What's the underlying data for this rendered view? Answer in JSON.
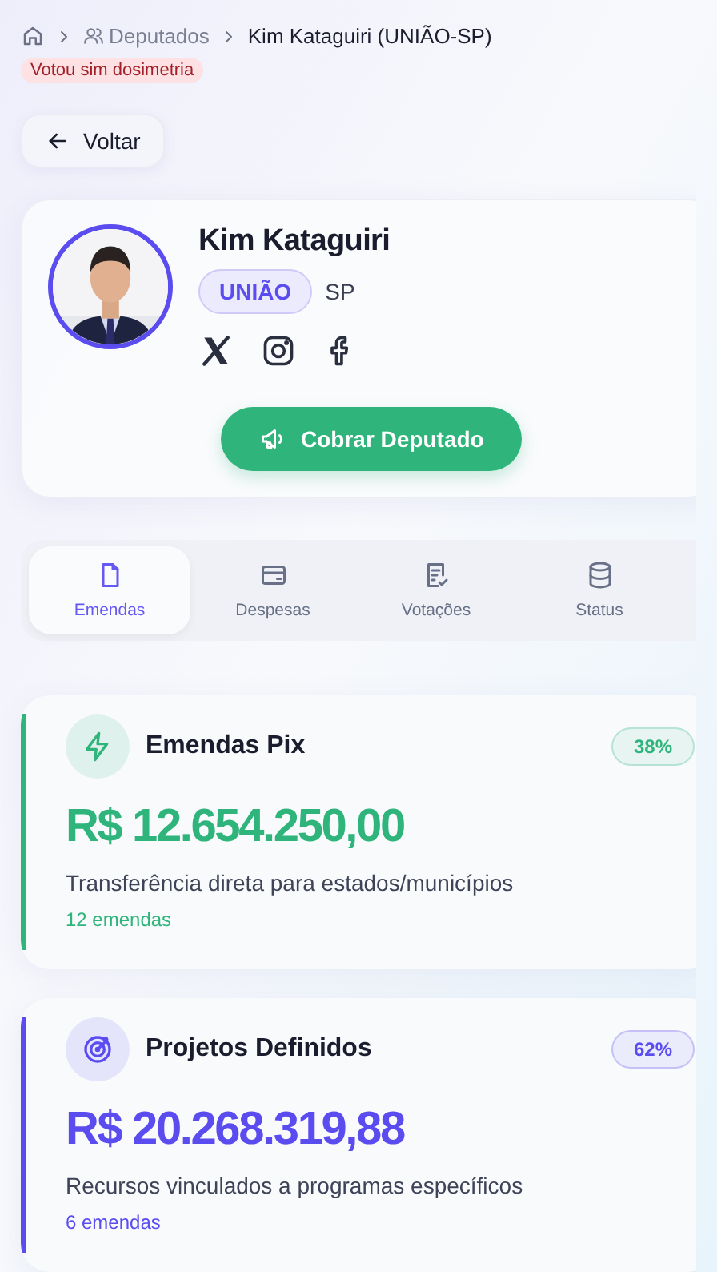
{
  "breadcrumb": [
    {
      "kind": "home"
    },
    {
      "kind": "people",
      "label": "Deputados"
    },
    {
      "kind": "current",
      "label": "Kim Kataguiri (UNIÃO-SP)"
    }
  ],
  "vote_badge": "Votou sim dosimetria",
  "back_button": "Voltar",
  "profile": {
    "name": "Kim Kataguiri",
    "party": "UNIÃO",
    "state": "SP",
    "socials": [
      {
        "kind": "x"
      },
      {
        "kind": "instagram"
      },
      {
        "kind": "facebook"
      }
    ],
    "action_button": "Cobrar Deputado"
  },
  "tabs": [
    {
      "label": "Emendas",
      "kind": "file",
      "selected": true
    },
    {
      "label": "Despesas",
      "kind": "wallet",
      "selected": false
    },
    {
      "label": "Votações",
      "kind": "checklist",
      "selected": false
    },
    {
      "label": "Status",
      "kind": "database",
      "selected": false
    }
  ],
  "funds": [
    {
      "kind": "bolt",
      "title": "Emendas Pix",
      "share": "38%",
      "amount": "R$ 12.654.250,00",
      "description": "Transferência direta para estados/municípios",
      "count": "12 emendas",
      "color": "#2fb57c"
    },
    {
      "kind": "target",
      "title": "Projetos Definidos",
      "share": "62%",
      "amount": "R$ 20.268.319,88",
      "description": "Recursos vinculados a programas específicos",
      "count": "6 emendas",
      "color": "#5b4cf0"
    }
  ]
}
